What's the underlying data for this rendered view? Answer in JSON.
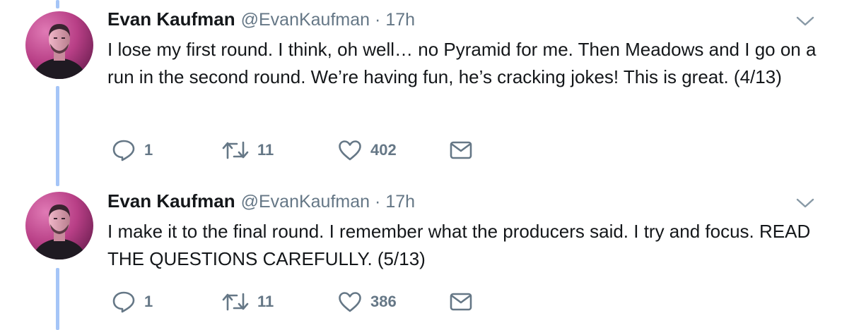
{
  "colors": {
    "thread_line": "#a5c5f7",
    "meta_text": "#657786",
    "body_text": "#14171a"
  },
  "tweets": [
    {
      "name": "Evan Kaufman",
      "handle": "@EvanKaufman",
      "separator": "·",
      "time": "17h",
      "text": "I lose my first round. I think, oh well… no Pyramid for me. Then Meadows and I go on a run in the second round. We’re having fun, he’s cracking jokes! This is great. (4/13)",
      "replies": "1",
      "retweets": "11",
      "likes": "402",
      "icons": [
        "reply-icon",
        "retweet-icon",
        "heart-icon",
        "direct-message-icon",
        "chevron-down-icon"
      ]
    },
    {
      "name": "Evan Kaufman",
      "handle": "@EvanKaufman",
      "separator": "·",
      "time": "17h",
      "text": "I make it to the final round. I remember what the producers said. I try and focus. READ THE QUESTIONS CAREFULLY. (5/13)",
      "replies": "1",
      "retweets": "11",
      "likes": "386",
      "icons": [
        "reply-icon",
        "retweet-icon",
        "heart-icon",
        "direct-message-icon",
        "chevron-down-icon"
      ]
    }
  ]
}
